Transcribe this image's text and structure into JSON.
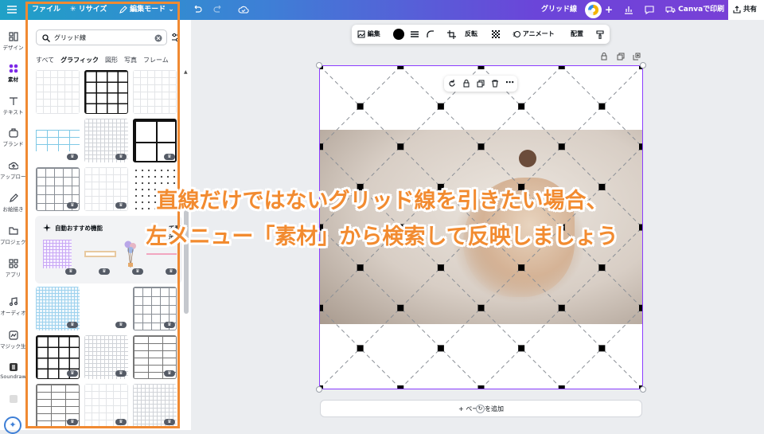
{
  "topbar": {
    "file": "ファイル",
    "resize": "✳ リサイズ",
    "edit_mode": "編集モード",
    "doc_title": "グリッド線",
    "print": "Canvaで印刷",
    "share": "共有"
  },
  "rail": [
    {
      "label": "デザイン",
      "icon": "layout-icon"
    },
    {
      "label": "素材",
      "icon": "elements-icon"
    },
    {
      "label": "テキスト",
      "icon": "text-icon"
    },
    {
      "label": "ブランド",
      "icon": "brand-icon"
    },
    {
      "label": "アップロード",
      "icon": "upload-icon"
    },
    {
      "label": "お絵描き",
      "icon": "draw-icon"
    },
    {
      "label": "プロジェクト",
      "icon": "folder-icon"
    },
    {
      "label": "アプリ",
      "icon": "apps-icon"
    },
    {
      "label": "オーディオ",
      "icon": "music-icon"
    },
    {
      "label": "マジック生成",
      "icon": "magic-media-icon"
    },
    {
      "label": "Soundraw",
      "icon": "soundraw-icon"
    },
    {
      "label": "",
      "icon": "app-icon"
    }
  ],
  "search": {
    "value": "グリッド線"
  },
  "tabs": [
    "すべて",
    "グラフィック",
    "図形",
    "写真",
    "フレーム"
  ],
  "autobox": {
    "label": "自動おすすめ機能",
    "label2": "て表示"
  },
  "context_toolbar": {
    "edit": "編集",
    "flip": "反転",
    "animate": "アニメート",
    "position": "配置"
  },
  "add_page": "+ ページを追加",
  "caption": {
    "line1": "直線だけではないグリッド線を引きたい場合、",
    "line2": "左メニュー「素材」から検索して反映しましょう"
  },
  "colors": {
    "accent": "#8b3dff",
    "caption": "#f28b30",
    "highlight_box": "#f08a32"
  }
}
